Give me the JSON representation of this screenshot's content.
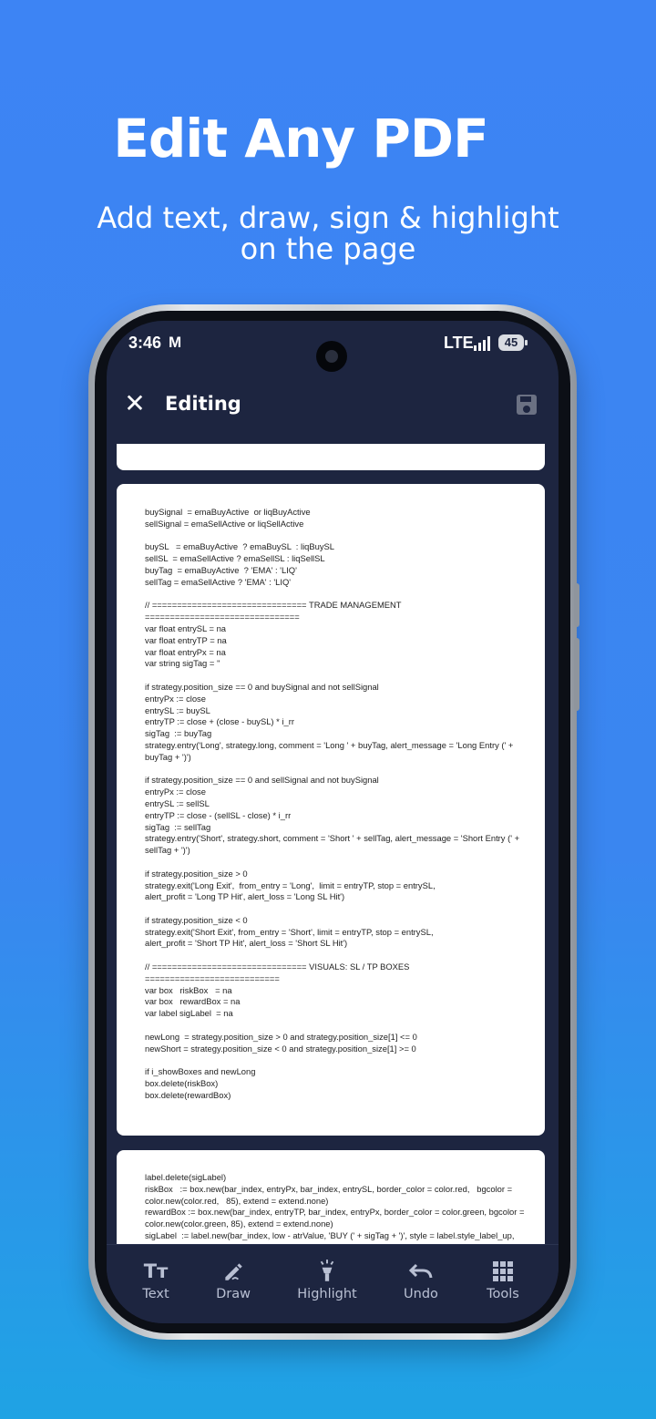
{
  "promo": {
    "headline": "Edit Any PDF",
    "subline": "Add text, draw, sign & highlight on the page"
  },
  "status_bar": {
    "time": "3:46",
    "notification_icon": "gmail-icon",
    "network": "LTE",
    "battery": "45"
  },
  "app_bar": {
    "close_icon": "close-icon",
    "title": "Editing",
    "save_icon": "save-icon"
  },
  "document": {
    "page2_text": "buySignal  = emaBuyActive  or liqBuyActive\nsellSignal = emaSellActive or liqSellActive\n\nbuySL   = emaBuyActive  ? emaBuySL  : liqBuySL\nsellSL  = emaSellActive ? emaSellSL : liqSellSL\nbuyTag  = emaBuyActive  ? 'EMA' : 'LIQ'\nsellTag = emaSellActive ? 'EMA' : 'LIQ'\n\n// =============================== TRADE MANAGEMENT\n===============================\nvar float entrySL = na\nvar float entryTP = na\nvar float entryPx = na\nvar string sigTag = ''\n\nif strategy.position_size == 0 and buySignal and not sellSignal\nentryPx := close\nentrySL := buySL\nentryTP := close + (close - buySL) * i_rr\nsigTag  := buyTag\nstrategy.entry('Long', strategy.long, comment = 'Long ' + buyTag, alert_message = 'Long Entry (' +\nbuyTag + ')')\n\nif strategy.position_size == 0 and sellSignal and not buySignal\nentryPx := close\nentrySL := sellSL\nentryTP := close - (sellSL - close) * i_rr\nsigTag  := sellTag\nstrategy.entry('Short', strategy.short, comment = 'Short ' + sellTag, alert_message = 'Short Entry (' +\nsellTag + ')')\n\nif strategy.position_size > 0\nstrategy.exit('Long Exit',  from_entry = 'Long',  limit = entryTP, stop = entrySL,\nalert_profit = 'Long TP Hit', alert_loss = 'Long SL Hit')\n\nif strategy.position_size < 0\nstrategy.exit('Short Exit', from_entry = 'Short', limit = entryTP, stop = entrySL,\nalert_profit = 'Short TP Hit', alert_loss = 'Short SL Hit')\n\n// =============================== VISUALS: SL / TP BOXES ===========================\nvar box   riskBox   = na\nvar box   rewardBox = na\nvar label sigLabel  = na\n\nnewLong  = strategy.position_size > 0 and strategy.position_size[1] <= 0\nnewShort = strategy.position_size < 0 and strategy.position_size[1] >= 0\n\nif i_showBoxes and newLong\nbox.delete(riskBox)\nbox.delete(rewardBox)",
    "page3_text": "label.delete(sigLabel)\nriskBox   := box.new(bar_index, entryPx, bar_index, entrySL, border_color = color.red,   bgcolor =\ncolor.new(color.red,   85), extend = extend.none)\nrewardBox := box.new(bar_index, entryTP, bar_index, entryPx, border_color = color.green, bgcolor =\ncolor.new(color.green, 85), extend = extend.none)\nsigLabel  := label.new(bar_index, low - atrValue, 'BUY (' + sigTag + ')', style = label.style_label_up, color ="
  },
  "toolbar": {
    "items": [
      {
        "label": "Text",
        "icon": "text-format-icon"
      },
      {
        "label": "Draw",
        "icon": "pencil-draw-icon"
      },
      {
        "label": "Highlight",
        "icon": "highlighter-icon"
      },
      {
        "label": "Undo",
        "icon": "undo-icon"
      },
      {
        "label": "Tools",
        "icon": "apps-grid-icon"
      }
    ],
    "text_icon_glyph": "Tт"
  },
  "colors": {
    "background_top": "#3d84f4",
    "background_bottom": "#1fa3e4",
    "app_navy": "#1d2540",
    "toolbar_text": "#b9c0d3"
  }
}
